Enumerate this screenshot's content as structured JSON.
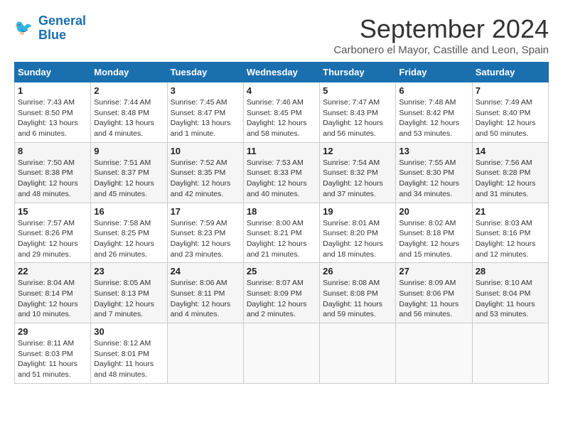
{
  "header": {
    "logo_line1": "General",
    "logo_line2": "Blue",
    "month_title": "September 2024",
    "subtitle": "Carbonero el Mayor, Castille and Leon, Spain"
  },
  "weekdays": [
    "Sunday",
    "Monday",
    "Tuesday",
    "Wednesday",
    "Thursday",
    "Friday",
    "Saturday"
  ],
  "weeks": [
    [
      {
        "day": "1",
        "info": "Sunrise: 7:43 AM\nSunset: 8:50 PM\nDaylight: 13 hours\nand 6 minutes."
      },
      {
        "day": "2",
        "info": "Sunrise: 7:44 AM\nSunset: 8:48 PM\nDaylight: 13 hours\nand 4 minutes."
      },
      {
        "day": "3",
        "info": "Sunrise: 7:45 AM\nSunset: 8:47 PM\nDaylight: 13 hours\nand 1 minute."
      },
      {
        "day": "4",
        "info": "Sunrise: 7:46 AM\nSunset: 8:45 PM\nDaylight: 12 hours\nand 58 minutes."
      },
      {
        "day": "5",
        "info": "Sunrise: 7:47 AM\nSunset: 8:43 PM\nDaylight: 12 hours\nand 56 minutes."
      },
      {
        "day": "6",
        "info": "Sunrise: 7:48 AM\nSunset: 8:42 PM\nDaylight: 12 hours\nand 53 minutes."
      },
      {
        "day": "7",
        "info": "Sunrise: 7:49 AM\nSunset: 8:40 PM\nDaylight: 12 hours\nand 50 minutes."
      }
    ],
    [
      {
        "day": "8",
        "info": "Sunrise: 7:50 AM\nSunset: 8:38 PM\nDaylight: 12 hours\nand 48 minutes."
      },
      {
        "day": "9",
        "info": "Sunrise: 7:51 AM\nSunset: 8:37 PM\nDaylight: 12 hours\nand 45 minutes."
      },
      {
        "day": "10",
        "info": "Sunrise: 7:52 AM\nSunset: 8:35 PM\nDaylight: 12 hours\nand 42 minutes."
      },
      {
        "day": "11",
        "info": "Sunrise: 7:53 AM\nSunset: 8:33 PM\nDaylight: 12 hours\nand 40 minutes."
      },
      {
        "day": "12",
        "info": "Sunrise: 7:54 AM\nSunset: 8:32 PM\nDaylight: 12 hours\nand 37 minutes."
      },
      {
        "day": "13",
        "info": "Sunrise: 7:55 AM\nSunset: 8:30 PM\nDaylight: 12 hours\nand 34 minutes."
      },
      {
        "day": "14",
        "info": "Sunrise: 7:56 AM\nSunset: 8:28 PM\nDaylight: 12 hours\nand 31 minutes."
      }
    ],
    [
      {
        "day": "15",
        "info": "Sunrise: 7:57 AM\nSunset: 8:26 PM\nDaylight: 12 hours\nand 29 minutes."
      },
      {
        "day": "16",
        "info": "Sunrise: 7:58 AM\nSunset: 8:25 PM\nDaylight: 12 hours\nand 26 minutes."
      },
      {
        "day": "17",
        "info": "Sunrise: 7:59 AM\nSunset: 8:23 PM\nDaylight: 12 hours\nand 23 minutes."
      },
      {
        "day": "18",
        "info": "Sunrise: 8:00 AM\nSunset: 8:21 PM\nDaylight: 12 hours\nand 21 minutes."
      },
      {
        "day": "19",
        "info": "Sunrise: 8:01 AM\nSunset: 8:20 PM\nDaylight: 12 hours\nand 18 minutes."
      },
      {
        "day": "20",
        "info": "Sunrise: 8:02 AM\nSunset: 8:18 PM\nDaylight: 12 hours\nand 15 minutes."
      },
      {
        "day": "21",
        "info": "Sunrise: 8:03 AM\nSunset: 8:16 PM\nDaylight: 12 hours\nand 12 minutes."
      }
    ],
    [
      {
        "day": "22",
        "info": "Sunrise: 8:04 AM\nSunset: 8:14 PM\nDaylight: 12 hours\nand 10 minutes."
      },
      {
        "day": "23",
        "info": "Sunrise: 8:05 AM\nSunset: 8:13 PM\nDaylight: 12 hours\nand 7 minutes."
      },
      {
        "day": "24",
        "info": "Sunrise: 8:06 AM\nSunset: 8:11 PM\nDaylight: 12 hours\nand 4 minutes."
      },
      {
        "day": "25",
        "info": "Sunrise: 8:07 AM\nSunset: 8:09 PM\nDaylight: 12 hours\nand 2 minutes."
      },
      {
        "day": "26",
        "info": "Sunrise: 8:08 AM\nSunset: 8:08 PM\nDaylight: 11 hours\nand 59 minutes."
      },
      {
        "day": "27",
        "info": "Sunrise: 8:09 AM\nSunset: 8:06 PM\nDaylight: 11 hours\nand 56 minutes."
      },
      {
        "day": "28",
        "info": "Sunrise: 8:10 AM\nSunset: 8:04 PM\nDaylight: 11 hours\nand 53 minutes."
      }
    ],
    [
      {
        "day": "29",
        "info": "Sunrise: 8:11 AM\nSunset: 8:03 PM\nDaylight: 11 hours\nand 51 minutes."
      },
      {
        "day": "30",
        "info": "Sunrise: 8:12 AM\nSunset: 8:01 PM\nDaylight: 11 hours\nand 48 minutes."
      },
      {
        "day": "",
        "info": ""
      },
      {
        "day": "",
        "info": ""
      },
      {
        "day": "",
        "info": ""
      },
      {
        "day": "",
        "info": ""
      },
      {
        "day": "",
        "info": ""
      }
    ]
  ]
}
